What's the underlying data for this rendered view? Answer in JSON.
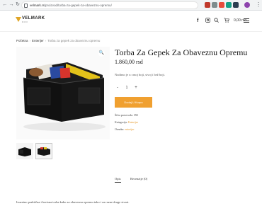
{
  "browser": {
    "url_host": "velmark.rs",
    "url_path": "/proizvod/torba-za-gepek-za-obaveznu-opremu/"
  },
  "site": {
    "logo_text": "VELMARK",
    "logo_sub": "DOO",
    "cart_total": "0,00 rsd"
  },
  "breadcrumb": {
    "home": "Početna",
    "category": "Enterijer",
    "current": "Torba za gepek za obaveznu opremu"
  },
  "product": {
    "title": "Torba Za Gepek Za Obaveznu Opremu",
    "price": "1.860,00 rsd",
    "description": "Nudimo je u crnoj boji, sivoj i bež boji.",
    "quantity": "1",
    "add_to_cart_label": "Dodaj U Korpu",
    "sku_label": "Šifra proizvoda:",
    "sku_value": "392",
    "category_label": "Kategorija:",
    "category_value": "Enterijer",
    "tag_label": "Oznaka:",
    "tag_value": "enterijer"
  },
  "tabs": [
    {
      "label": "Opis"
    },
    {
      "label": "Recenzije (0)"
    }
  ],
  "tab_content": "Izuzetno praktična i korisna torba kako za obaveznu opremu tako i za razne druge stvari.",
  "colors": {
    "accent": "#f0a030",
    "logo_gold": "#e0a526"
  }
}
